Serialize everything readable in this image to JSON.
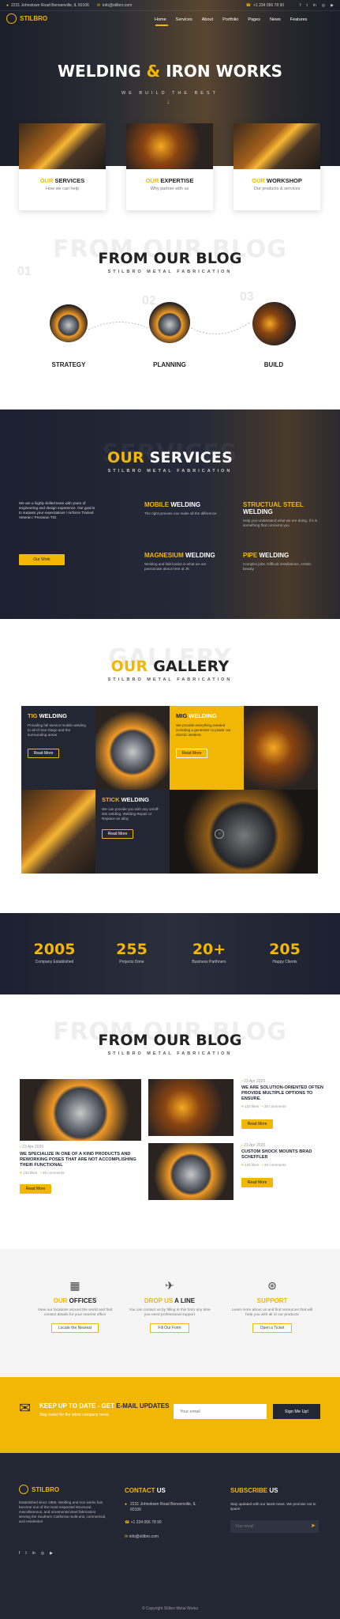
{
  "topbar": {
    "address": "2231 Johnstown Road Bensenville, IL 60106",
    "email": "info@stilbro.com",
    "phone": "+1 234 056 78 90"
  },
  "brand": {
    "name": "STILBRO"
  },
  "nav": [
    "Home",
    "Services",
    "About",
    "Portfolio",
    "Pages",
    "News",
    "Features"
  ],
  "hero": {
    "title_a": "WELDING",
    "amp": "&",
    "title_b": "IRON WORKS",
    "subtitle": "WE BUILD THE BEST"
  },
  "hero_cards": [
    {
      "title_a": "OUR",
      "title_b": " SERVICES",
      "text": "How we can help"
    },
    {
      "title_a": "OUR",
      "title_b": " EXPERTISE",
      "text": "Why partner with us"
    },
    {
      "title_a": "OUR",
      "title_b": " WORKSHOP",
      "text": "Our products & services"
    }
  ],
  "blog1": {
    "ghost": "FROM OUR BLOG",
    "title": "FROM OUR BLOG",
    "sub": "STILBRO METAL FABRICATION",
    "steps": [
      {
        "num": "01",
        "label": "STRATEGY"
      },
      {
        "num": "02",
        "label": "PLANNING"
      },
      {
        "num": "03",
        "label": "BUILD"
      }
    ]
  },
  "services": {
    "title_a": "OUR",
    "title_b": " SERVICES",
    "sub": "STILBRO METAL FABRICATION",
    "intro": "We are a highly skilled team with years of engineering and design experience. Our goal is to surpass your expectations / Airforce Trained Veteran / Precision TIG",
    "intro_btn": "Our Work",
    "items": [
      {
        "title_a": "MOBILE",
        "title_b": " WELDING",
        "text": "The right process can make all the difference"
      },
      {
        "title_a": "STRUCTUAL STEEL",
        "title_b": " WELDING",
        "text": "Help you understand what we are doing. If it is something that concerns you"
      },
      {
        "title_a": "MAGNESIUM",
        "title_b": " WELDING",
        "text": "Welding and fabrication is what we are passionate about here at JK"
      },
      {
        "title_a": "PIPE",
        "title_b": " WELDING",
        "text": "Complex jobs. Difficult installations. Artistic beauty"
      }
    ]
  },
  "gallery": {
    "ghost": "GALLERY",
    "title_a": "OUR",
    "title_b": " GALLERY",
    "sub": "STILBRO METAL FABRICATION",
    "cards": [
      {
        "title_a": "TIG",
        "title_b": " WELDING",
        "text": "Providing full service mobile welding to all of San Diego and the surrounding areas",
        "btn": "Read More"
      },
      {
        "title_a": "MIG",
        "title_b": " WELDING",
        "text": "We provide everything needed including a generator to power our electric welders",
        "btn": "Read More"
      },
      {
        "title_a": "STICK",
        "title_b": " WELDING",
        "text": "We can provide you with any on/off-site welding, Welding Repair or Replace an alloy",
        "btn": "Read More"
      }
    ]
  },
  "stats": [
    {
      "num": "2005",
      "label": "Company Established"
    },
    {
      "num": "255",
      "label": "Projects Done"
    },
    {
      "num": "20+",
      "label": "Business Parthners"
    },
    {
      "num": "205",
      "label": "Happy Clients"
    }
  ],
  "blog2": {
    "ghost": "FROM OUR BLOG",
    "title": "FROM OUR BLOG",
    "sub": "STILBRO METAL FABRICATION",
    "main": {
      "date": "23 Apr 2020",
      "title": "WE SPECIALIZE IN ONE OF A KIND PRODUCTS AND REWORKING POSES THAT ARE NOT ACCOMPLISHING THEIR FUNCTIONAL",
      "views": "133 likes",
      "comments": "38 comments",
      "btn": "Read More"
    },
    "side": [
      {
        "date": "23 Apr 2020",
        "title": "WE ARE SOLUTION-ORIENTED OFTEN PROVIDE MULTIPLE OPTIONS TO ENSURE.",
        "views": "133 likes",
        "comments": "38 comments",
        "btn": "Read More"
      },
      {
        "date": "23 Apr 2020",
        "title": "CUSTOM SHOCK MOUNTS BRAD SCHEFFLER",
        "views": "133 likes",
        "comments": "38 comments",
        "btn": "Read More"
      }
    ]
  },
  "contact_boxes": [
    {
      "title_a": "OUR",
      "title_b": " OFFICES",
      "text": "View our locations around the world and find contact details for your nearest office",
      "btn": "Locate the Nearest"
    },
    {
      "title_a": "DROP US",
      "title_b": " A LINE",
      "text": "You can contact us by filling in this form any time you need professional support",
      "btn": "Fill Our Form"
    },
    {
      "title_a": "SUPPORT",
      "title_b": "",
      "text": "Learn more about us and find resources that will help you with all of our products",
      "btn": "Open a Ticket"
    }
  ],
  "newsletter": {
    "title_a": "KEEP UP TO DATE - GET",
    "title_b": " E-MAIL UPDATES",
    "text": "Stay tuned for the latest company news.",
    "placeholder": "Your email",
    "btn": "Sign Me Up!"
  },
  "footer": {
    "about": "Established since 1989, Welding and iron works has become one of the most respected structural, miscellaneous, and ornamental steel fabricators serving the Southern California multi-unit, commercial, and residential",
    "contact_title_a": "CONTACT",
    "contact_title_b": " US",
    "address": "2231 Johnstown Road Bensenville, IL 60106",
    "phone": "+1 234 056 78 90",
    "email": "info@stilbro.com",
    "sub_title_a": "SUBSCRIBE",
    "sub_title_b": " US",
    "sub_text": "Stay updated with our latest news. We promise not to spam!",
    "placeholder": "Your email",
    "copyright": "© Copyright Stilbro Metal Works"
  },
  "colors": {
    "accent": "#f2b705",
    "dark": "#232734"
  }
}
